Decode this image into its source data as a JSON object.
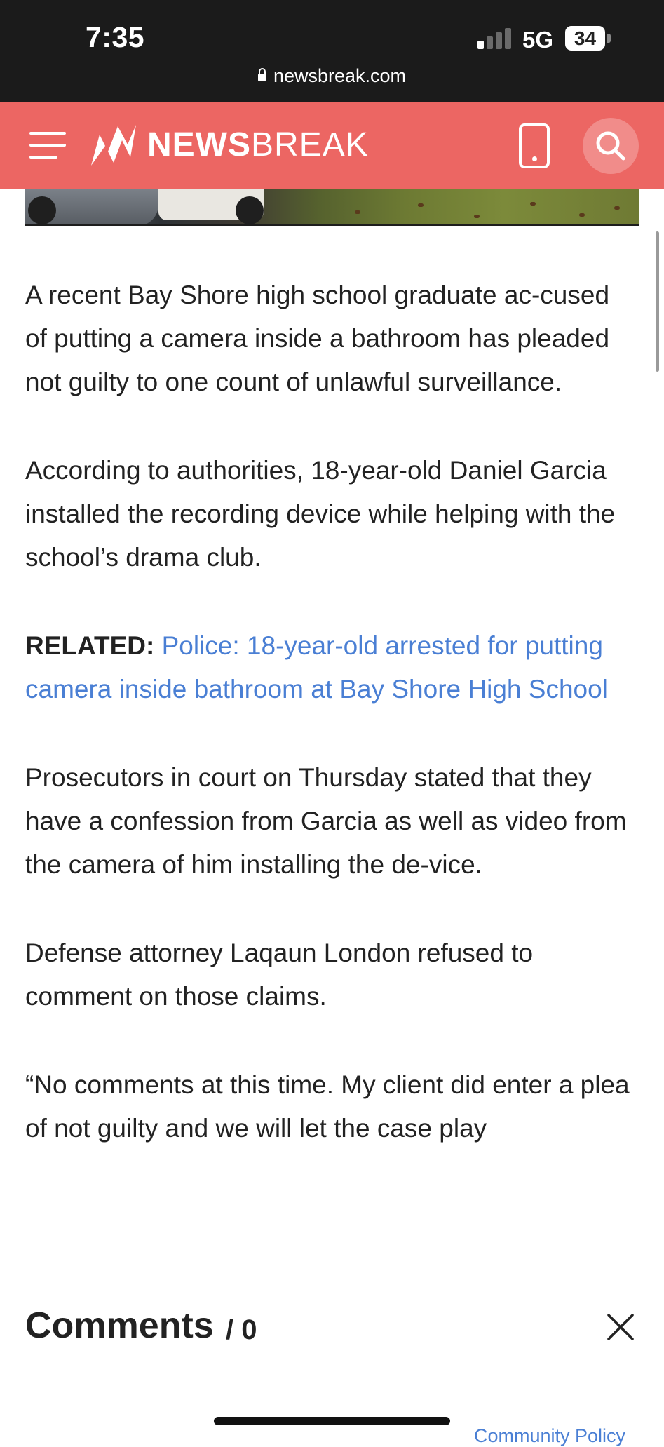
{
  "status_bar": {
    "time": "7:35",
    "network": "5G",
    "battery": "34",
    "url": "newsbreak.com"
  },
  "header": {
    "logo_bold": "NEWS",
    "logo_light": "BREAK",
    "brand_color": "#ec6663",
    "icons": [
      "menu-icon",
      "newsbreak-logo-icon",
      "phone-icon",
      "search-icon"
    ]
  },
  "article": {
    "paragraphs": [
      "A recent Bay Shore high school graduate ac-cused of putting a camera inside a bathroom has pleaded not guilty to one count of unlawful surveillance.",
      "According to authorities, 18-year-old Daniel Garcia installed the recording device while helping with the school’s drama club."
    ],
    "related": {
      "label": "RELATED:",
      "link_text": "Police: 18-year-old arrested for putting camera inside bathroom at Bay Shore High School"
    },
    "paragraphs_after": [
      "Prosecutors in court on Thursday stated that they have a confession from Garcia as well as video from the camera of him installing the de-vice.",
      "Defense attorney Laqaun London refused to comment on those claims.",
      "“No comments at this time. My client did enter a plea of not guilty and we will let the case play"
    ],
    "link_color": "#4a7fd4"
  },
  "comments": {
    "title": "Comments",
    "count": "/ 0",
    "close_icon": "close-icon",
    "community_policy": "Community Policy"
  }
}
